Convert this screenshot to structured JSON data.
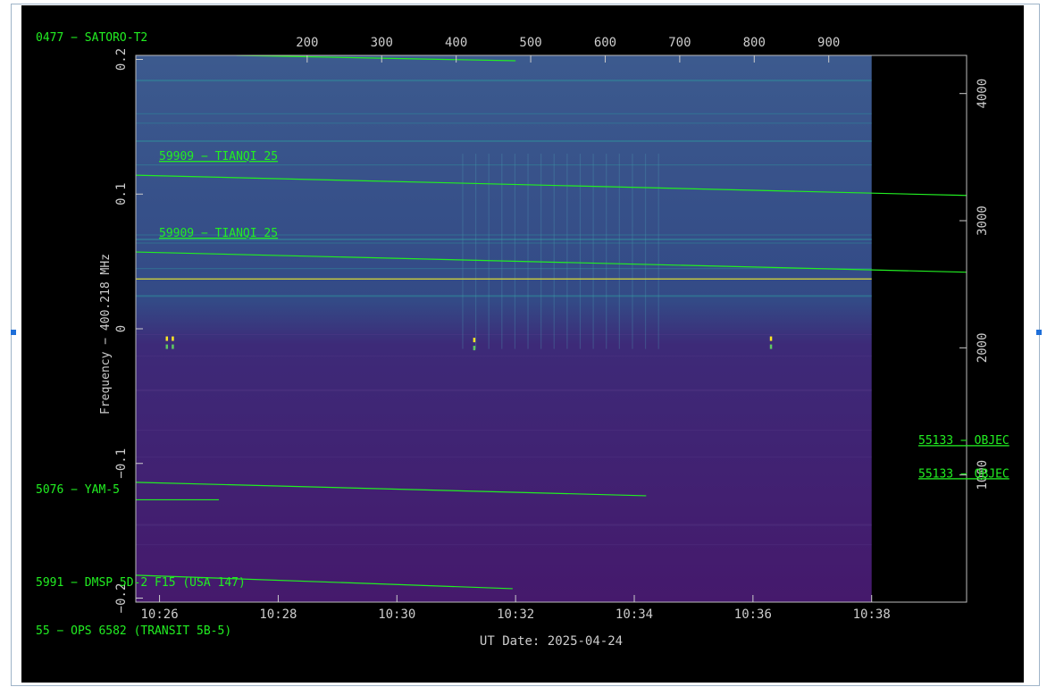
{
  "chart_data": {
    "type": "heatmap",
    "title": "",
    "xlabel": "UT Date: 2025-04-24",
    "ylabel": "Frequency − 400.218 MHz",
    "x_ticks": [
      "10:26",
      "10:28",
      "10:30",
      "10:32",
      "10:34",
      "10:36",
      "10:38"
    ],
    "x_tick_minutes": [
      26,
      28,
      30,
      32,
      34,
      36,
      38
    ],
    "xlim_minutes": [
      25.6,
      39.6
    ],
    "data_end_minutes": 38.0,
    "y_ticks": [
      -0.2,
      -0.1,
      0,
      0.1,
      0.2
    ],
    "y_tick_labels": [
      "−0.2",
      "−0.1",
      "0",
      "0.1",
      "0.2"
    ],
    "ylim": [
      -0.203,
      0.203
    ],
    "top_axis": {
      "ticks": [
        200,
        300,
        400,
        500,
        600,
        700,
        800,
        900
      ],
      "range": [
        -30,
        1085
      ]
    },
    "right_axis": {
      "ticks": [
        1000,
        2000,
        3000,
        4000
      ],
      "labels": [
        "1000",
        "2000",
        "3000",
        "4000"
      ],
      "range": [
        0,
        4300
      ]
    },
    "colormap": [
      "#440154",
      "#3b528b",
      "#21918c",
      "#5ec962",
      "#fde725"
    ],
    "trace_color": "#22ee22",
    "reference_line": {
      "y": 0.037,
      "color": "#dddd33"
    },
    "tracks": [
      {
        "label": "0477 − SATORO-T2",
        "x": [
          27.3,
          32.0
        ],
        "y": [
          0.203,
          0.199
        ],
        "label_pos": "top-left"
      },
      {
        "label": "59909 − TIANQI 25",
        "x": [
          25.6,
          39.6
        ],
        "y": [
          0.114,
          0.099
        ],
        "label_pos": "inline"
      },
      {
        "label": "59909 − TIANQI 25",
        "x": [
          25.6,
          39.6
        ],
        "y": [
          0.057,
          0.042
        ],
        "label_pos": "inline"
      },
      {
        "label": "5076 − YAM-5",
        "x": [
          25.6,
          34.2
        ],
        "y": [
          -0.114,
          -0.124
        ],
        "label_pos": "left"
      },
      {
        "label": "",
        "x": [
          25.6,
          27.0
        ],
        "y": [
          -0.127,
          -0.127
        ],
        "label_pos": "none"
      },
      {
        "label": "5991 − DMSP 5D-2 F15 (USA 147)",
        "x": [
          25.6,
          31.95
        ],
        "y": [
          -0.183,
          -0.193
        ],
        "label_pos": "left"
      },
      {
        "label": "55 − OPS 6582 (TRANSIT 5B-5)",
        "x": [],
        "y": [],
        "label_pos": "below"
      }
    ],
    "right_labels": [
      {
        "label": "55133 − OBJEC",
        "right_axis_value": 1270
      },
      {
        "label": "55133 − OBJEC",
        "right_axis_value": 1010
      }
    ],
    "bursts": [
      {
        "x": 26.12,
        "y": -0.011
      },
      {
        "x": 26.22,
        "y": -0.011
      },
      {
        "x": 31.3,
        "y": -0.012
      },
      {
        "x": 36.3,
        "y": -0.011
      }
    ],
    "grid": false
  }
}
